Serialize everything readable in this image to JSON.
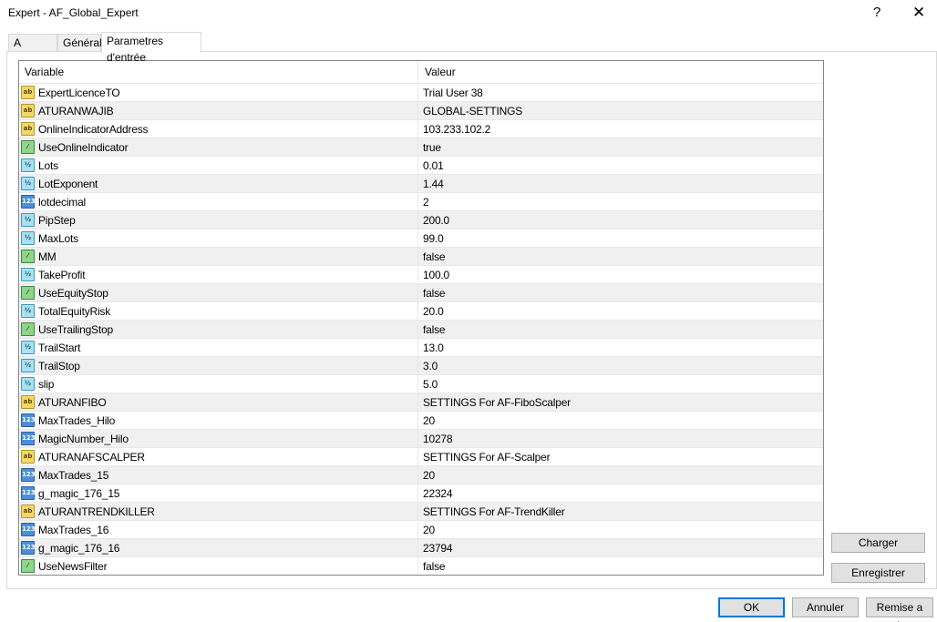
{
  "window": {
    "title": "Expert - AF_Global_Expert",
    "help": "?",
    "close": "✕"
  },
  "tabs": [
    {
      "label": "A propos"
    },
    {
      "label": "Général"
    },
    {
      "label": "Parametres d'entrée"
    }
  ],
  "table": {
    "headers": {
      "variable": "Variable",
      "value": "Valeur"
    },
    "rows": [
      {
        "name": "ExpertLicenceTO",
        "value": "Trial User 38",
        "type": "string",
        "icon_text": "ab"
      },
      {
        "name": "ATURANWAJIB",
        "value": "GLOBAL-SETTINGS",
        "type": "string",
        "icon_text": "ab"
      },
      {
        "name": "OnlineIndicatorAddress",
        "value": "103.233.102.2",
        "type": "string",
        "icon_text": "ab"
      },
      {
        "name": "UseOnlineIndicator",
        "value": "true",
        "type": "bool",
        "icon_text": "⁄"
      },
      {
        "name": "Lots",
        "value": "0.01",
        "type": "double",
        "icon_text": "½"
      },
      {
        "name": "LotExponent",
        "value": "1.44",
        "type": "double",
        "icon_text": "½"
      },
      {
        "name": "lotdecimal",
        "value": "2",
        "type": "int",
        "icon_text": "123"
      },
      {
        "name": "PipStep",
        "value": "200.0",
        "type": "double",
        "icon_text": "½"
      },
      {
        "name": "MaxLots",
        "value": "99.0",
        "type": "double",
        "icon_text": "½"
      },
      {
        "name": "MM",
        "value": "false",
        "type": "bool",
        "icon_text": "⁄"
      },
      {
        "name": "TakeProfit",
        "value": "100.0",
        "type": "double",
        "icon_text": "½"
      },
      {
        "name": "UseEquityStop",
        "value": "false",
        "type": "bool",
        "icon_text": "⁄"
      },
      {
        "name": "TotalEquityRisk",
        "value": "20.0",
        "type": "double",
        "icon_text": "½"
      },
      {
        "name": "UseTrailingStop",
        "value": "false",
        "type": "bool",
        "icon_text": "⁄"
      },
      {
        "name": "TrailStart",
        "value": "13.0",
        "type": "double",
        "icon_text": "½"
      },
      {
        "name": "TrailStop",
        "value": "3.0",
        "type": "double",
        "icon_text": "½"
      },
      {
        "name": "slip",
        "value": "5.0",
        "type": "double",
        "icon_text": "½"
      },
      {
        "name": "ATURANFIBO",
        "value": "SETTINGS For AF-FiboScalper",
        "type": "string",
        "icon_text": "ab"
      },
      {
        "name": "MaxTrades_Hilo",
        "value": "20",
        "type": "int",
        "icon_text": "123"
      },
      {
        "name": "MagicNumber_Hilo",
        "value": "10278",
        "type": "int",
        "icon_text": "123"
      },
      {
        "name": "ATURANAFSCALPER",
        "value": "SETTINGS For AF-Scalper",
        "type": "string",
        "icon_text": "ab"
      },
      {
        "name": "MaxTrades_15",
        "value": "20",
        "type": "int",
        "icon_text": "123"
      },
      {
        "name": "g_magic_176_15",
        "value": "22324",
        "type": "int",
        "icon_text": "123"
      },
      {
        "name": "ATURANTRENDKILLER",
        "value": "SETTINGS For AF-TrendKiller",
        "type": "string",
        "icon_text": "ab"
      },
      {
        "name": "MaxTrades_16",
        "value": "20",
        "type": "int",
        "icon_text": "123"
      },
      {
        "name": "g_magic_176_16",
        "value": "23794",
        "type": "int",
        "icon_text": "123"
      },
      {
        "name": "UseNewsFilter",
        "value": "false",
        "type": "bool",
        "icon_text": "⁄"
      }
    ]
  },
  "side_buttons": {
    "load": "Charger",
    "save": "Enregistrer"
  },
  "footer_buttons": {
    "ok": "OK",
    "cancel": "Annuler",
    "reset": "Remise a zéro"
  }
}
